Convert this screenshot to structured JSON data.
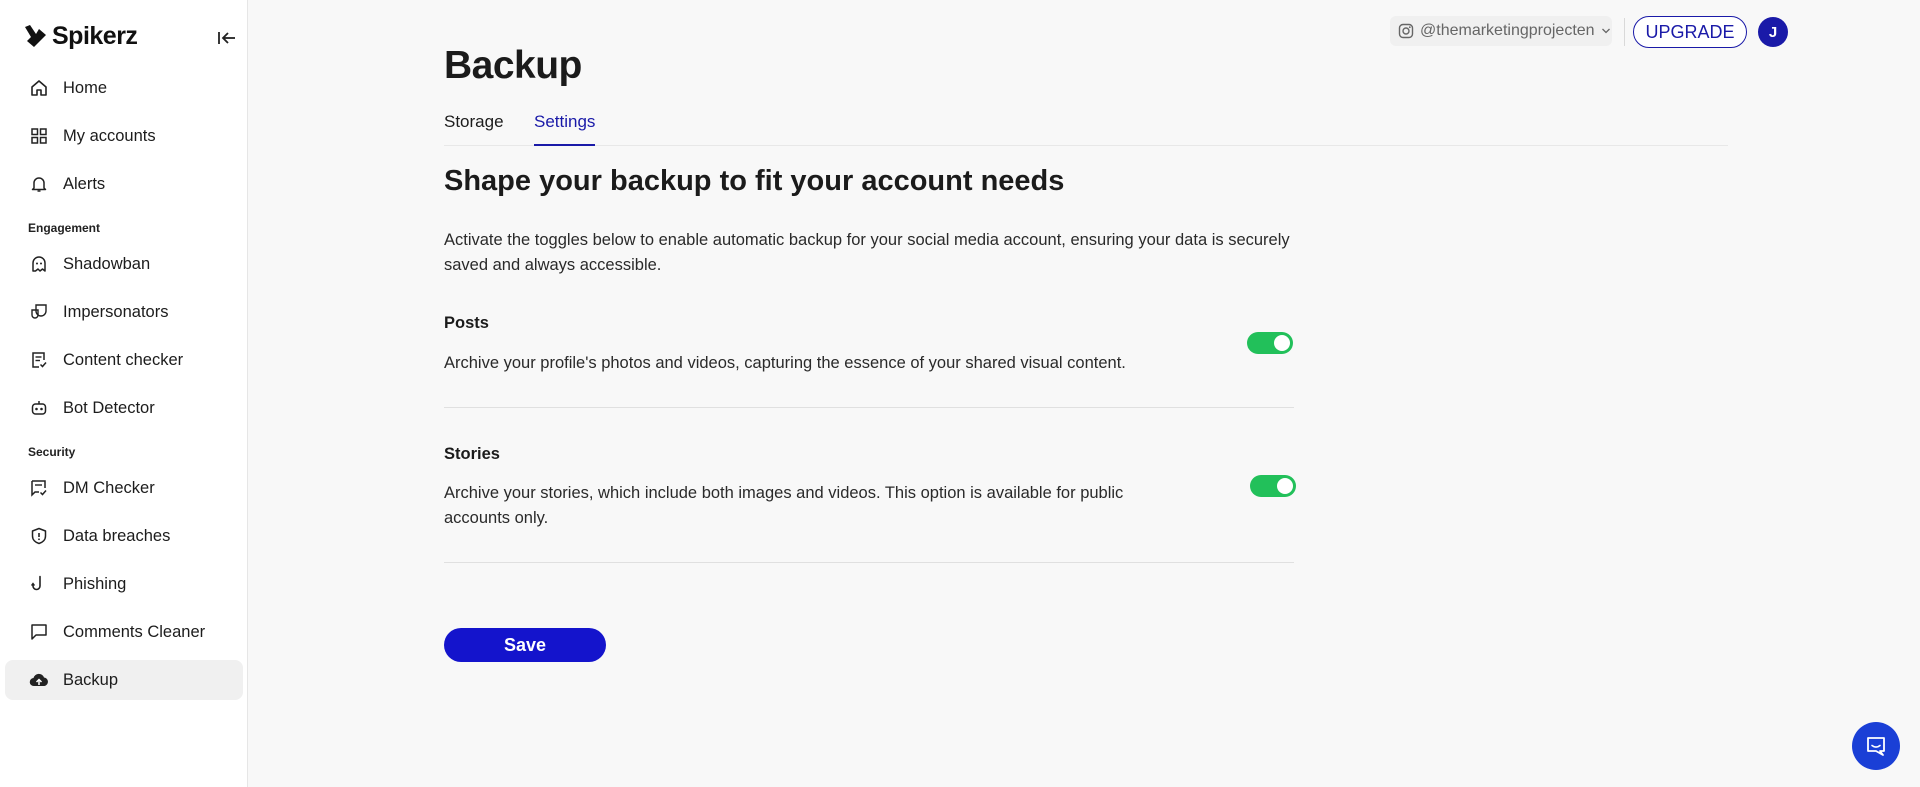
{
  "brand": {
    "name": "Spikerz"
  },
  "sidebar": {
    "items": [
      {
        "label": "Home",
        "icon": "home-icon"
      },
      {
        "label": "My accounts",
        "icon": "grid-icon"
      },
      {
        "label": "Alerts",
        "icon": "bell-icon"
      }
    ],
    "engagement_label": "Engagement",
    "engagement_items": [
      {
        "label": "Shadowban",
        "icon": "ghost-icon"
      },
      {
        "label": "Impersonators",
        "icon": "masks-icon"
      },
      {
        "label": "Content checker",
        "icon": "checklist-icon"
      },
      {
        "label": "Bot Detector",
        "icon": "robot-icon"
      }
    ],
    "security_label": "Security",
    "security_items": [
      {
        "label": "DM Checker",
        "icon": "message-check-icon"
      },
      {
        "label": "Data breaches",
        "icon": "shield-icon"
      },
      {
        "label": "Phishing",
        "icon": "hook-icon"
      },
      {
        "label": "Comments Cleaner",
        "icon": "comment-icon"
      },
      {
        "label": "Backup",
        "icon": "cloud-upload-icon",
        "active": true
      }
    ]
  },
  "topbar": {
    "account": "@themarketingprojecten",
    "upgrade_label": "UPGRADE",
    "avatar_initial": "J"
  },
  "main": {
    "title": "Backup",
    "tabs": [
      {
        "label": "Storage",
        "active": false
      },
      {
        "label": "Settings",
        "active": true
      }
    ],
    "heading": "Shape your backup to fit your account needs",
    "intro": "Activate the toggles below to enable automatic backup for your social media account, ensuring your data is securely saved and always accessible.",
    "options": [
      {
        "title": "Posts",
        "description": "Archive your profile's photos and videos, capturing the essence of your shared visual content.",
        "enabled": true
      },
      {
        "title": "Stories",
        "description": "Archive your stories, which include both images and videos. This option is available for public accounts only.",
        "enabled": true
      }
    ],
    "save_label": "Save"
  },
  "colors": {
    "accent": "#1a1aa8",
    "toggle_on": "#22c05a",
    "save_button": "#1414cc"
  }
}
